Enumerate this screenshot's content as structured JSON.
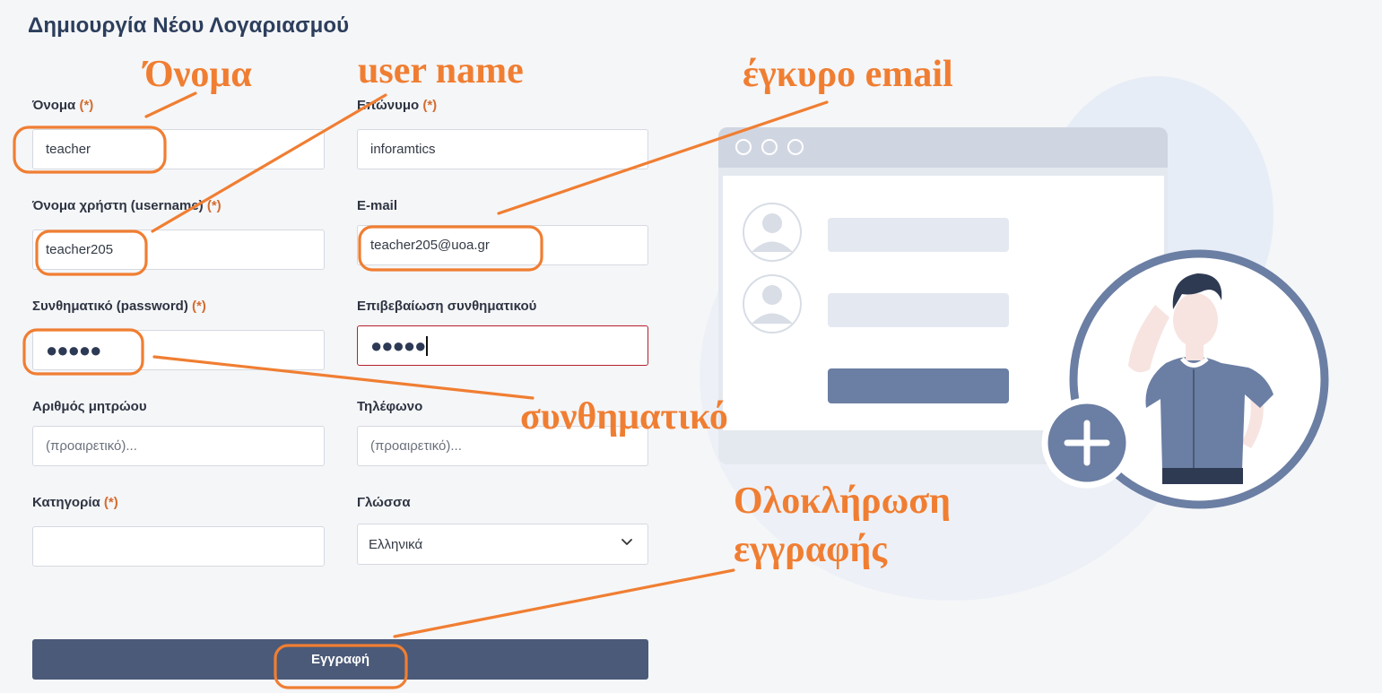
{
  "page": {
    "title": "Δημιουργία Νέου Λογαριασμού"
  },
  "form": {
    "required_mark": "(*)",
    "first_name": {
      "label": "Όνομα",
      "value": "teacher"
    },
    "last_name": {
      "label": "Επώνυμο",
      "value": "inforamtics"
    },
    "username": {
      "label": "Όνομα χρήστη (username)",
      "value": "teacher205"
    },
    "email": {
      "label": "E-mail",
      "value": "teacher205@uoa.gr"
    },
    "password": {
      "label": "Συνθηματικό (password)",
      "value": "●●●●●"
    },
    "password_confirm": {
      "label": "Επιβεβαίωση συνθηματικού",
      "value": "●●●●●"
    },
    "registry_number": {
      "label": "Αριθμός μητρώου",
      "placeholder": "(προαιρετικό)..."
    },
    "phone": {
      "label": "Τηλέφωνο",
      "placeholder": "(προαιρετικό)..."
    },
    "category": {
      "label": "Κατηγορία",
      "value": ""
    },
    "language": {
      "label": "Γλώσσα",
      "selected": "Ελληνικά"
    },
    "submit_label": "Εγγραφή"
  },
  "annotations": {
    "name": "Όνομα",
    "username": "user name",
    "email": "έγκυρο email",
    "password": "συνθηματικό",
    "complete_line1": "Ολοκλήρωση",
    "complete_line2": "εγγραφής"
  },
  "colors": {
    "accent_orange": "#f07e32",
    "button_bg": "#4b5a78",
    "title_text": "#2c3e5c",
    "error_border": "#b5202b",
    "illustration_blue": "#6b7ea3"
  },
  "icons": [
    "user-avatar-icon",
    "plus-icon",
    "chevron-down-icon",
    "window-dots-icon"
  ]
}
